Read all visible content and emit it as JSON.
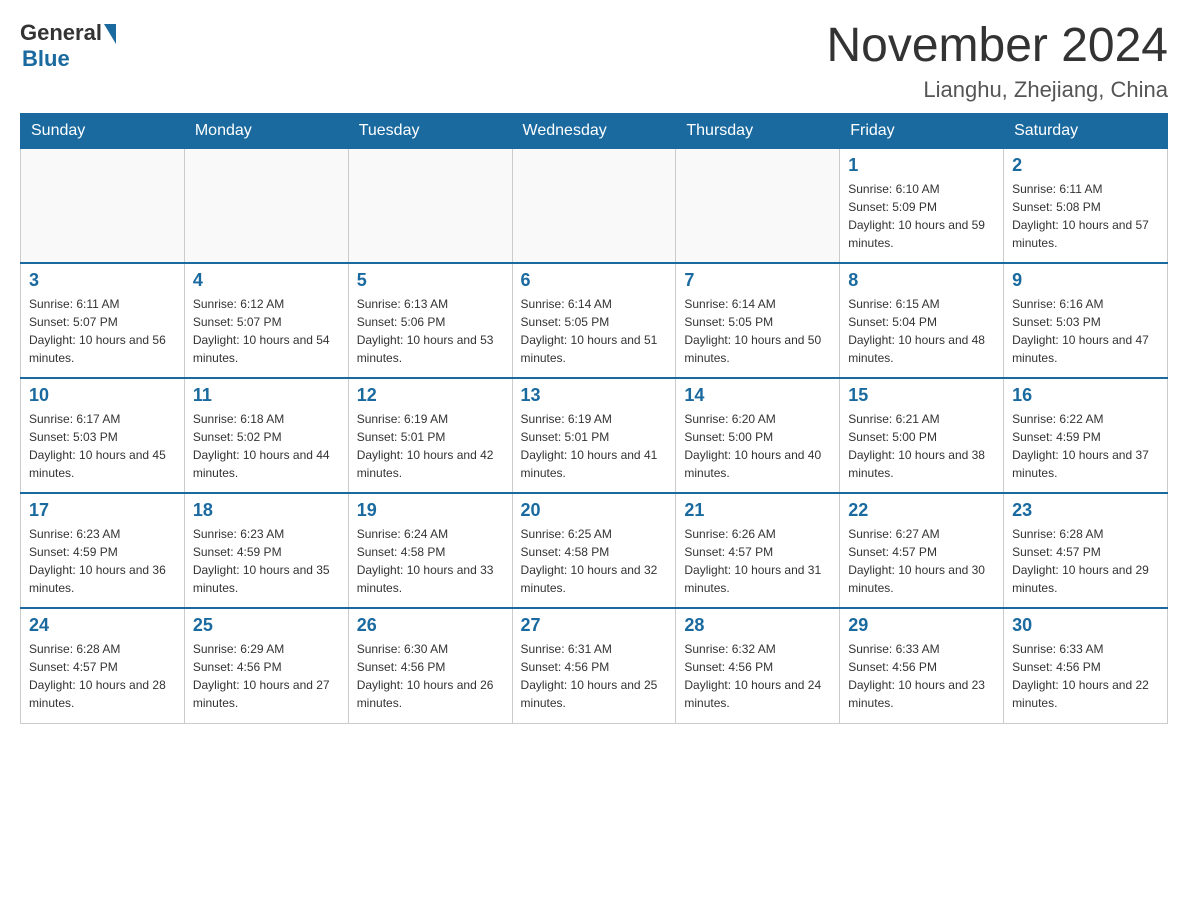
{
  "logo": {
    "general": "General",
    "blue": "Blue"
  },
  "title": {
    "month_year": "November 2024",
    "location": "Lianghu, Zhejiang, China"
  },
  "days_of_week": [
    "Sunday",
    "Monday",
    "Tuesday",
    "Wednesday",
    "Thursday",
    "Friday",
    "Saturday"
  ],
  "weeks": [
    [
      {
        "day": "",
        "info": ""
      },
      {
        "day": "",
        "info": ""
      },
      {
        "day": "",
        "info": ""
      },
      {
        "day": "",
        "info": ""
      },
      {
        "day": "",
        "info": ""
      },
      {
        "day": "1",
        "info": "Sunrise: 6:10 AM\nSunset: 5:09 PM\nDaylight: 10 hours and 59 minutes."
      },
      {
        "day": "2",
        "info": "Sunrise: 6:11 AM\nSunset: 5:08 PM\nDaylight: 10 hours and 57 minutes."
      }
    ],
    [
      {
        "day": "3",
        "info": "Sunrise: 6:11 AM\nSunset: 5:07 PM\nDaylight: 10 hours and 56 minutes."
      },
      {
        "day": "4",
        "info": "Sunrise: 6:12 AM\nSunset: 5:07 PM\nDaylight: 10 hours and 54 minutes."
      },
      {
        "day": "5",
        "info": "Sunrise: 6:13 AM\nSunset: 5:06 PM\nDaylight: 10 hours and 53 minutes."
      },
      {
        "day": "6",
        "info": "Sunrise: 6:14 AM\nSunset: 5:05 PM\nDaylight: 10 hours and 51 minutes."
      },
      {
        "day": "7",
        "info": "Sunrise: 6:14 AM\nSunset: 5:05 PM\nDaylight: 10 hours and 50 minutes."
      },
      {
        "day": "8",
        "info": "Sunrise: 6:15 AM\nSunset: 5:04 PM\nDaylight: 10 hours and 48 minutes."
      },
      {
        "day": "9",
        "info": "Sunrise: 6:16 AM\nSunset: 5:03 PM\nDaylight: 10 hours and 47 minutes."
      }
    ],
    [
      {
        "day": "10",
        "info": "Sunrise: 6:17 AM\nSunset: 5:03 PM\nDaylight: 10 hours and 45 minutes."
      },
      {
        "day": "11",
        "info": "Sunrise: 6:18 AM\nSunset: 5:02 PM\nDaylight: 10 hours and 44 minutes."
      },
      {
        "day": "12",
        "info": "Sunrise: 6:19 AM\nSunset: 5:01 PM\nDaylight: 10 hours and 42 minutes."
      },
      {
        "day": "13",
        "info": "Sunrise: 6:19 AM\nSunset: 5:01 PM\nDaylight: 10 hours and 41 minutes."
      },
      {
        "day": "14",
        "info": "Sunrise: 6:20 AM\nSunset: 5:00 PM\nDaylight: 10 hours and 40 minutes."
      },
      {
        "day": "15",
        "info": "Sunrise: 6:21 AM\nSunset: 5:00 PM\nDaylight: 10 hours and 38 minutes."
      },
      {
        "day": "16",
        "info": "Sunrise: 6:22 AM\nSunset: 4:59 PM\nDaylight: 10 hours and 37 minutes."
      }
    ],
    [
      {
        "day": "17",
        "info": "Sunrise: 6:23 AM\nSunset: 4:59 PM\nDaylight: 10 hours and 36 minutes."
      },
      {
        "day": "18",
        "info": "Sunrise: 6:23 AM\nSunset: 4:59 PM\nDaylight: 10 hours and 35 minutes."
      },
      {
        "day": "19",
        "info": "Sunrise: 6:24 AM\nSunset: 4:58 PM\nDaylight: 10 hours and 33 minutes."
      },
      {
        "day": "20",
        "info": "Sunrise: 6:25 AM\nSunset: 4:58 PM\nDaylight: 10 hours and 32 minutes."
      },
      {
        "day": "21",
        "info": "Sunrise: 6:26 AM\nSunset: 4:57 PM\nDaylight: 10 hours and 31 minutes."
      },
      {
        "day": "22",
        "info": "Sunrise: 6:27 AM\nSunset: 4:57 PM\nDaylight: 10 hours and 30 minutes."
      },
      {
        "day": "23",
        "info": "Sunrise: 6:28 AM\nSunset: 4:57 PM\nDaylight: 10 hours and 29 minutes."
      }
    ],
    [
      {
        "day": "24",
        "info": "Sunrise: 6:28 AM\nSunset: 4:57 PM\nDaylight: 10 hours and 28 minutes."
      },
      {
        "day": "25",
        "info": "Sunrise: 6:29 AM\nSunset: 4:56 PM\nDaylight: 10 hours and 27 minutes."
      },
      {
        "day": "26",
        "info": "Sunrise: 6:30 AM\nSunset: 4:56 PM\nDaylight: 10 hours and 26 minutes."
      },
      {
        "day": "27",
        "info": "Sunrise: 6:31 AM\nSunset: 4:56 PM\nDaylight: 10 hours and 25 minutes."
      },
      {
        "day": "28",
        "info": "Sunrise: 6:32 AM\nSunset: 4:56 PM\nDaylight: 10 hours and 24 minutes."
      },
      {
        "day": "29",
        "info": "Sunrise: 6:33 AM\nSunset: 4:56 PM\nDaylight: 10 hours and 23 minutes."
      },
      {
        "day": "30",
        "info": "Sunrise: 6:33 AM\nSunset: 4:56 PM\nDaylight: 10 hours and 22 minutes."
      }
    ]
  ]
}
